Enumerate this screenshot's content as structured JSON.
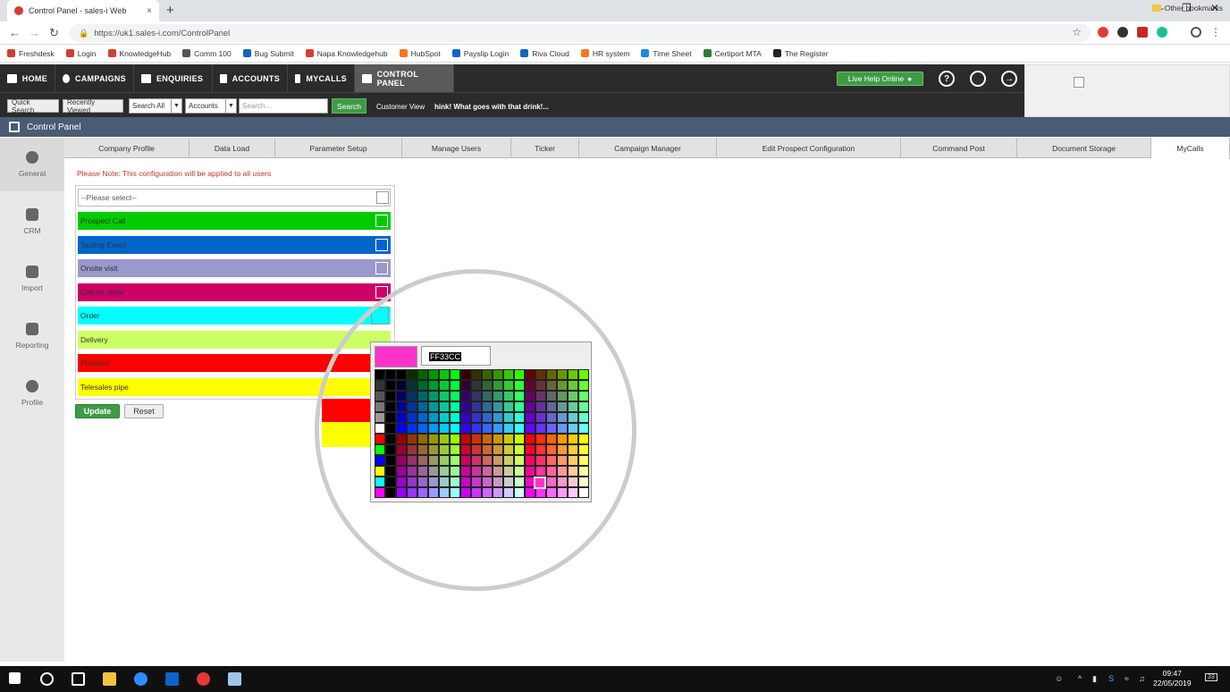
{
  "browser": {
    "tab_title": "Control Panel - sales-i Web",
    "tab_close": "×",
    "new_tab": "+",
    "url": "https://uk1.sales-i.com/ControlPanel",
    "bookmarks": [
      {
        "label": "Freshdesk",
        "color": "#d23f31"
      },
      {
        "label": "Login",
        "color": "#d23f31"
      },
      {
        "label": "KnowledgeHub",
        "color": "#d23f31"
      },
      {
        "label": "Comm 100",
        "color": "#555555"
      },
      {
        "label": "Bug Submit",
        "color": "#1565c0"
      },
      {
        "label": "Napa Knowledgehub",
        "color": "#d23f31"
      },
      {
        "label": "HubSpot",
        "color": "#f57722"
      },
      {
        "label": "Payslip Login",
        "color": "#1565c0"
      },
      {
        "label": "Riva Cloud",
        "color": "#1565c0"
      },
      {
        "label": "HR system",
        "color": "#f57722"
      },
      {
        "label": "Time Sheet",
        "color": "#1e88e5"
      },
      {
        "label": "Certiport MTA",
        "color": "#2e7d32"
      },
      {
        "label": "The Register",
        "color": "#222222"
      }
    ],
    "other_bookmarks": "Other bookmarks"
  },
  "nav": {
    "items": [
      "HOME",
      "CAMPAIGNS",
      "ENQUIRIES",
      "ACCOUNTS",
      "MYCALLS",
      "CONTROL PANEL"
    ],
    "live_help": "Live Help Online",
    "help": "?"
  },
  "search": {
    "quick_search": "Quick Search",
    "recently_viewed": "Recently Viewed",
    "search_all": "Search All",
    "accounts": "Accounts",
    "placeholder": "Search...",
    "search_button": "Search",
    "customer_view": "Customer View",
    "ticker": "hink! What goes with that drink!..."
  },
  "control_panel": {
    "title": "Control Panel",
    "tabs": [
      "Company Profile",
      "Data Load",
      "Parameter Setup",
      "Manage Users",
      "Ticker",
      "Campaign Manager",
      "Edit Prospect Configuration",
      "Command Post",
      "Document Storage",
      "MyCalls"
    ],
    "active_tab": "MyCalls"
  },
  "sidebar": [
    {
      "label": "General"
    },
    {
      "label": "CRM"
    },
    {
      "label": "Import"
    },
    {
      "label": "Reporting"
    },
    {
      "label": "Profile"
    }
  ],
  "config": {
    "note": "Please Note: This configuration will be applied to all users",
    "select_placeholder": "--Please select--",
    "rows": [
      {
        "label": "Prospect Call",
        "color": "#00cc00"
      },
      {
        "label": "Tasting Event",
        "color": "#0066cc"
      },
      {
        "label": "Onsite visit",
        "color": "#9999cc"
      },
      {
        "label": "Call for order",
        "color": "#cc0066"
      },
      {
        "label": "Order",
        "color": "#00ffff"
      },
      {
        "label": "Delivery",
        "color": "#ccff66"
      },
      {
        "label": "Problem",
        "color": "#ff0000"
      },
      {
        "label": "Telesales pipe",
        "color": "#ffff00"
      }
    ],
    "update": "Update",
    "reset": "Reset"
  },
  "color_picker": {
    "hex": "FF33CC",
    "preview_color": "#ff33cc"
  },
  "taskbar": {
    "time": "09:47",
    "date": "22/05/2019",
    "notifications": "33"
  }
}
